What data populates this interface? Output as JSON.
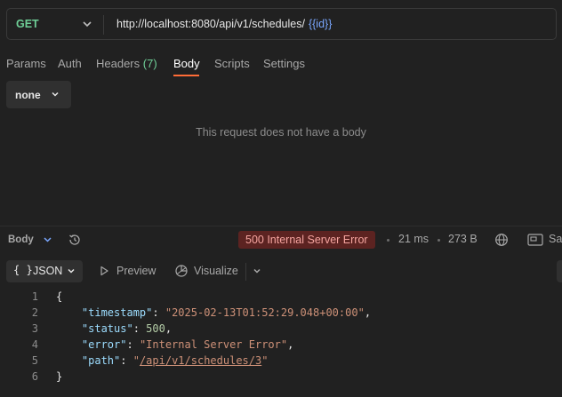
{
  "request": {
    "method": "GET",
    "url": "http://localhost:8080/api/v1/schedules/",
    "url_variable": "{{id}}"
  },
  "tabs": {
    "params": "Params",
    "auth": "Auth",
    "headers": "Headers",
    "headers_count": "(7)",
    "body": "Body",
    "scripts": "Scripts",
    "settings": "Settings"
  },
  "body_type": "none",
  "no_body_message": "This request does not have a body",
  "response": {
    "label": "Body",
    "status": "500 Internal Server Error",
    "time": "21 ms",
    "size": "273 B",
    "save_label": "Sa",
    "format": "JSON",
    "format_icon": "{ }",
    "preview": "Preview",
    "visualize": "Visualize",
    "line_numbers": [
      "1",
      "2",
      "3",
      "4",
      "5",
      "6"
    ],
    "code": {
      "open": "{",
      "close": "}",
      "timestamp_key": "\"timestamp\"",
      "timestamp_value": "\"2025-02-13T01:52:29.048+00:00\"",
      "status_key": "\"status\"",
      "status_value": "500",
      "error_key": "\"error\"",
      "error_value": "\"Internal Server Error\"",
      "path_key": "\"path\"",
      "path_quote": "\"",
      "path_value": "/api/v1/schedules/3"
    }
  },
  "icons": {
    "method_dropdown": "chevron-down-icon",
    "history": "history-icon",
    "globe": "globe-icon",
    "save": "save-response-icon",
    "preview": "play-icon",
    "visualize": "visualize-icon"
  },
  "colors": {
    "method_get": "#6fcf97",
    "active_tab_underline": "#ff6c37",
    "status_error_bg": "#5c2321",
    "status_error_text": "#f6a5a0",
    "url_variable": "#7aa7ff"
  }
}
